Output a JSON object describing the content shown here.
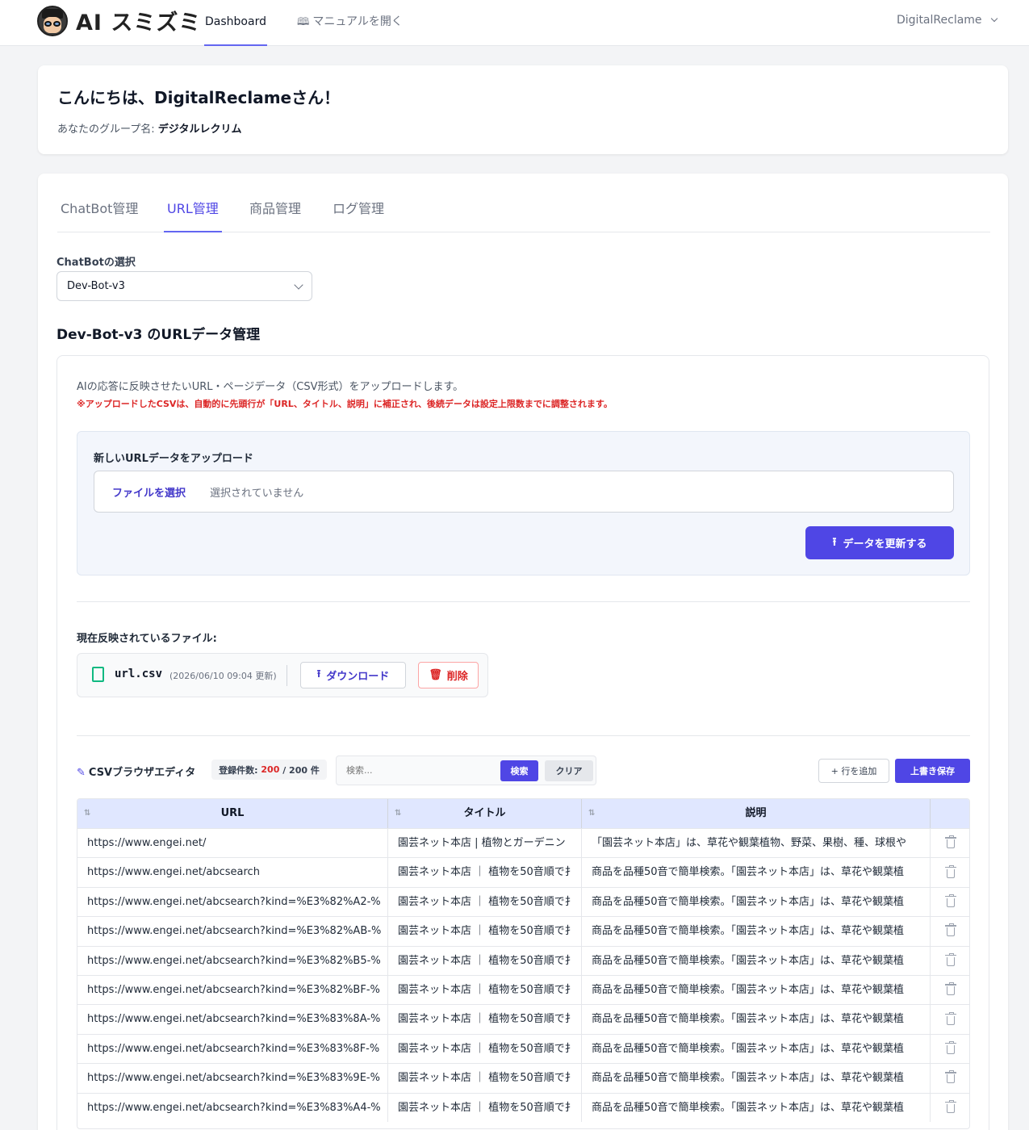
{
  "app": {
    "logo_text": "AI スミズミ"
  },
  "nav": {
    "dashboard": "Dashboard",
    "manual": "マニュアルを開く",
    "user": "DigitalReclame"
  },
  "greeting": {
    "title": "こんにちは、DigitalReclameさん！",
    "group_label": "あなたのグループ名:",
    "group_name": "デジタルレクリム"
  },
  "tabs": [
    "ChatBot管理",
    "URL管理",
    "商品管理",
    "ログ管理"
  ],
  "chatbot_select": {
    "label": "ChatBotの選択",
    "value": "Dev-Bot-v3"
  },
  "section": {
    "title": "Dev-Bot-v3 のURLデータ管理",
    "info": "AIの応答に反映させたいURL・ページデータ（CSV形式）をアップロードします。",
    "warning": "※アップロードしたCSVは、自動的に先頭行が「URL、タイトル、説明」に補正され、後続データは設定上限数までに調整されます。"
  },
  "upload": {
    "title": "新しいURLデータをアップロード",
    "choose_file": "ファイルを選択",
    "no_file": "選択されていません",
    "submit": "データを更新する"
  },
  "current_file": {
    "label": "現在反映されているファイル:",
    "name": "url.csv",
    "updated": "(2026/06/10 09:04 更新)",
    "download": "ダウンロード",
    "delete": "削除"
  },
  "editor": {
    "title": "CSVブラウザエディタ",
    "count_label": "登録件数:",
    "count": "200",
    "count_total": "/ 200 件",
    "search_placeholder": "検索...",
    "search_btn": "検索",
    "clear_btn": "クリア",
    "add_row": "+ 行を追加",
    "save": "上書き保存",
    "columns": [
      "URL",
      "タイトル",
      "説明"
    ],
    "rows": [
      {
        "url": "https://www.engei.net/",
        "title": "園芸ネット本店 | 植物とガーデニン",
        "desc": "「園芸ネット本店」は、草花や観葉植物、野菜、果樹、種、球根や"
      },
      {
        "url": "https://www.engei.net/abcsearch",
        "title": "園芸ネット本店 ｜ 植物を50音順で扌",
        "desc": "商品を品種50音で簡単検索。「園芸ネット本店」は、草花や観葉植"
      },
      {
        "url": "https://www.engei.net/abcsearch?kind=%E3%82%A2-%",
        "title": "園芸ネット本店 ｜ 植物を50音順で扌",
        "desc": "商品を品種50音で簡単検索。「園芸ネット本店」は、草花や観葉植"
      },
      {
        "url": "https://www.engei.net/abcsearch?kind=%E3%82%AB-%",
        "title": "園芸ネット本店 ｜ 植物を50音順で扌",
        "desc": "商品を品種50音で簡単検索。「園芸ネット本店」は、草花や観葉植"
      },
      {
        "url": "https://www.engei.net/abcsearch?kind=%E3%82%B5-%",
        "title": "園芸ネット本店 ｜ 植物を50音順で扌",
        "desc": "商品を品種50音で簡単検索。「園芸ネット本店」は、草花や観葉植"
      },
      {
        "url": "https://www.engei.net/abcsearch?kind=%E3%82%BF-%",
        "title": "園芸ネット本店 ｜ 植物を50音順で扌",
        "desc": "商品を品種50音で簡単検索。「園芸ネット本店」は、草花や観葉植"
      },
      {
        "url": "https://www.engei.net/abcsearch?kind=%E3%83%8A-%",
        "title": "園芸ネット本店 ｜ 植物を50音順で扌",
        "desc": "商品を品種50音で簡単検索。「園芸ネット本店」は、草花や観葉植"
      },
      {
        "url": "https://www.engei.net/abcsearch?kind=%E3%83%8F-%",
        "title": "園芸ネット本店 ｜ 植物を50音順で扌",
        "desc": "商品を品種50音で簡単検索。「園芸ネット本店」は、草花や観葉植"
      },
      {
        "url": "https://www.engei.net/abcsearch?kind=%E3%83%9E-%",
        "title": "園芸ネット本店 ｜ 植物を50音順で扌",
        "desc": "商品を品種50音で簡単検索。「園芸ネット本店」は、草花や観葉植"
      },
      {
        "url": "https://www.engei.net/abcsearch?kind=%E3%83%A4-%",
        "title": "園芸ネット本店 ｜ 植物を50音順で扌",
        "desc": "商品を品種50音で簡単検索。「園芸ネット本店」は、草花や観葉植"
      }
    ]
  },
  "colors": {
    "accent": "#4f46e5",
    "danger": "#dc2626",
    "count": "#dc2626"
  }
}
